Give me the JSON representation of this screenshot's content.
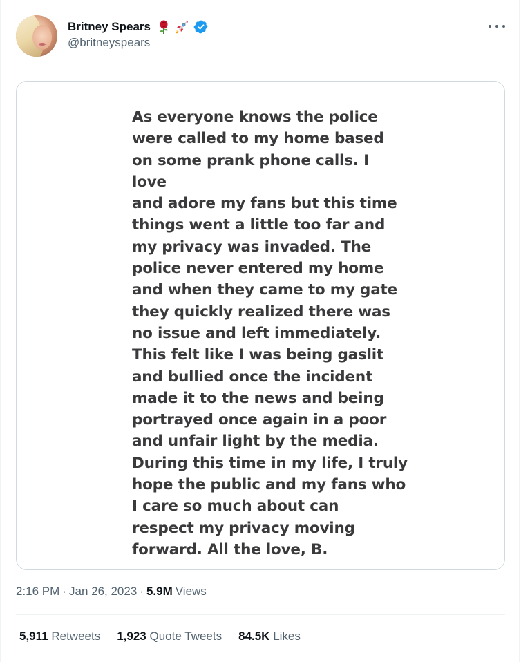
{
  "user": {
    "display_name": "Britney Spears",
    "handle": "@britneyspears",
    "emojis": [
      "rose-emoji",
      "rocket-emoji"
    ],
    "verified": true,
    "verified_color": "#1d9bf0"
  },
  "media": {
    "text": "As everyone knows the police\nwere called to my home based\non some prank phone calls. I love\nand adore my fans but this time\nthings went a little too far and\nmy privacy was invaded. The\npolice never entered my home\nand when they came to my gate\nthey quickly realized there was\nno issue and left immediately.\nThis felt like I was being gaslit\nand bullied once the incident\nmade it to the news and being\nportrayed once again in a poor\nand unfair light by the media.\nDuring this time in my life, I truly\nhope the public and my fans who\nI care so much about can\nrespect my privacy moving\nforward. All the love, B."
  },
  "meta": {
    "time": "2:16 PM",
    "dot1": "·",
    "date": "Jan 26, 2023",
    "dot2": "·",
    "views_count": "5.9M",
    "views_label": "Views"
  },
  "stats": {
    "retweets_count": "5,911",
    "retweets_label": "Retweets",
    "quotes_count": "1,923",
    "quotes_label": "Quote Tweets",
    "likes_count": "84.5K",
    "likes_label": "Likes"
  },
  "colors": {
    "text_primary": "#0f1419",
    "text_secondary": "#536471",
    "border": "#cfd9de",
    "accent": "#1d9bf0"
  }
}
